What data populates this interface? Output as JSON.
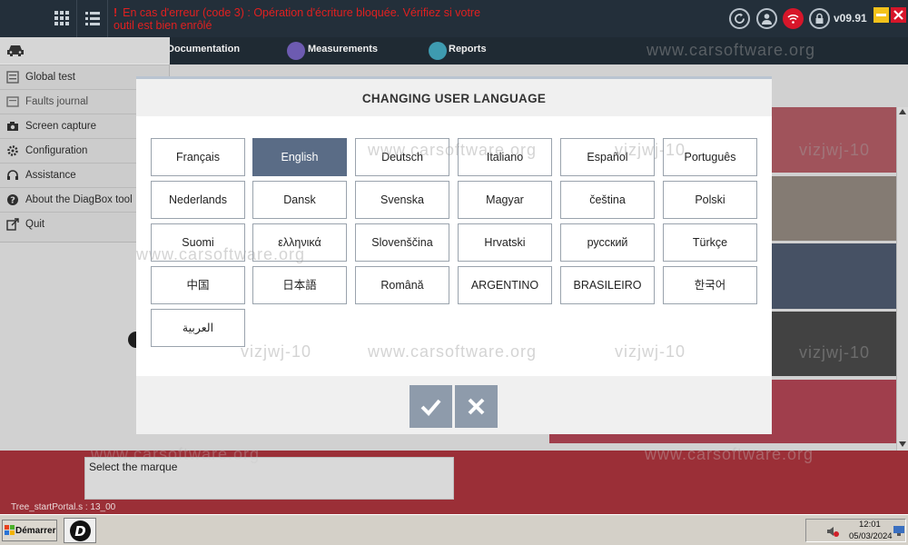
{
  "topbar": {
    "error_message": "Opération d'écriture bloquée. Vérifiez si votre outil est bien enrôlé",
    "error_prefix": "En cas d'erreur (code 3) :",
    "version": "v09.91"
  },
  "nav": {
    "documentation": "Documentation",
    "measurements": "Measurements",
    "reports": "Reports"
  },
  "left_menu": {
    "items": [
      {
        "label": "Global test",
        "icon": "list-icon"
      },
      {
        "label": "Faults journal",
        "icon": "journal-icon"
      },
      {
        "label": "Screen capture",
        "icon": "camera-icon"
      },
      {
        "label": "Configuration",
        "icon": "gear-icon"
      },
      {
        "label": "Assistance",
        "icon": "headset-icon"
      },
      {
        "label": "About the DiagBox tool",
        "icon": "question-icon"
      },
      {
        "label": "Quit",
        "icon": "exit-icon"
      }
    ]
  },
  "dialog": {
    "title": "CHANGING USER LANGUAGE",
    "selected": "English",
    "languages": [
      "Français",
      "English",
      "Deutsch",
      "Italiano",
      "Español",
      "Português",
      "Nederlands",
      "Dansk",
      "Svenska",
      "Magyar",
      "čeština",
      "Polski",
      "Suomi",
      "ελληνικά",
      "Slovenščina",
      "Hrvatski",
      "русский",
      "Türkçe",
      "中国",
      "日本語",
      "Română",
      "ARGENTINO",
      "BRASILEIRO",
      "한국어",
      "العربية"
    ]
  },
  "main": {
    "marque_label": "Select the marque",
    "tree_label": "Tree_startPortal.s : 13_00"
  },
  "watermarks": [
    "www.carsoftware.org",
    "vizjwj-10"
  ],
  "taskbar": {
    "start_label": "Démarrer",
    "time": "12:01",
    "date": "05/03/2024"
  },
  "colors": {
    "selected_language": "#5a6c86",
    "action_button": "#8e9bab",
    "error_text": "#e02020",
    "bottom_band": "#9b2f37"
  }
}
